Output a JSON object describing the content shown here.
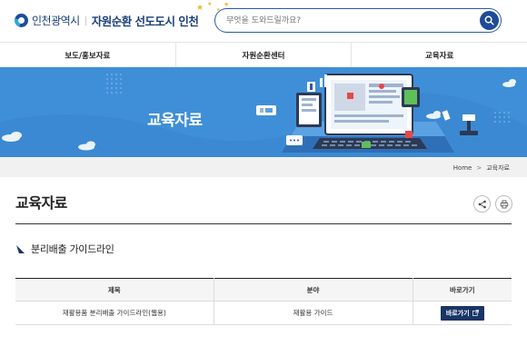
{
  "header": {
    "city_name": "인천광역시",
    "slogan": "자원순환 선도도시 인천",
    "search": {
      "placeholder": "무엇을 도와드릴까요?"
    }
  },
  "nav": {
    "items": [
      {
        "label": "보도/홍보자료"
      },
      {
        "label": "자원순환센터"
      },
      {
        "label": "교육자료"
      }
    ]
  },
  "banner": {
    "title": "교육자료"
  },
  "breadcrumb": {
    "home": "Home",
    "separator": ">",
    "current": "교육자료"
  },
  "page": {
    "title": "교육자료"
  },
  "section": {
    "title": "분리배출 가이드라인"
  },
  "table": {
    "headers": [
      "제목",
      "분야",
      "바로가기"
    ],
    "rows": [
      {
        "title": "재활용품 분리배출 가이드라인(웹용)",
        "category": "재활용 가이드",
        "link_label": "바로가기"
      }
    ]
  },
  "colors": {
    "primary": "#1d4a9a",
    "banner": "#3f8fd8",
    "button": "#1a3566",
    "star": "#f2b632"
  }
}
